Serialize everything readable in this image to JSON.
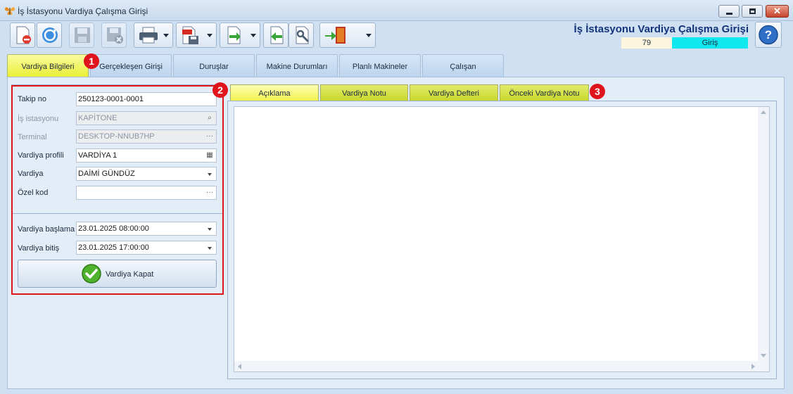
{
  "window": {
    "title": "İş İstasyonu Vardiya Çalışma Girişi",
    "app_icon": "butterfly-icon",
    "controls": {
      "minimize": "minimize-icon",
      "maximize": "maximize-icon",
      "close": "close-icon"
    }
  },
  "toolbar": {
    "buttons": [
      {
        "icon": "new-document-icon"
      },
      {
        "icon": "refresh-icon"
      },
      {
        "icon": "save-icon"
      },
      {
        "icon": "delete-save-icon"
      },
      {
        "icon": "printer-icon"
      },
      {
        "icon": "pdf-export-icon"
      },
      {
        "icon": "import-icon"
      },
      {
        "icon": "back-icon"
      },
      {
        "icon": "tools-icon"
      },
      {
        "icon": "exit-door-icon"
      }
    ]
  },
  "header": {
    "title": "İş İstasyonu Vardiya Çalışma Girişi",
    "counter": "79",
    "mode": "Giriş",
    "mode_color": "#10e8f0",
    "help_icon": "help-icon"
  },
  "main_tabs": [
    {
      "label": "Vardiya Bilgileri",
      "active": true
    },
    {
      "label": "Gerçekleşen Girişi"
    },
    {
      "label": "Duruşlar"
    },
    {
      "label": "Makine Durumları"
    },
    {
      "label": "Planlı Makineler"
    },
    {
      "label": "Çalışan"
    }
  ],
  "form": {
    "tracking_no": {
      "label": "Takip no",
      "value": "250123-0001-0001"
    },
    "workstation": {
      "label": "İş istasyonu",
      "value": "KAPİTONE"
    },
    "terminal": {
      "label": "Terminal",
      "value": "DESKTOP-NNUB7HP"
    },
    "shift_profile": {
      "label": "Vardiya profili",
      "value": "VARDİYA 1"
    },
    "shift": {
      "label": "Vardiya",
      "value": "DAİMİ GÜNDÜZ"
    },
    "special_code": {
      "label": "Özel kod",
      "value": ""
    },
    "shift_start": {
      "label": "Vardiya başlama",
      "value": "23.01.2025 08:00:00"
    },
    "shift_end": {
      "label": "Vardiya bitiş",
      "value": "23.01.2025 17:00:00"
    },
    "close_shift_button": "Vardiya Kapat"
  },
  "sub_tabs": [
    {
      "label": "Açıklama",
      "active": true
    },
    {
      "label": "Vardiya Notu"
    },
    {
      "label": "Vardiya Defteri"
    },
    {
      "label": "Önceki Vardiya Notu"
    }
  ],
  "annotations": [
    "1",
    "2",
    "3"
  ],
  "accent_colors": {
    "active_tab": "#f2f44a",
    "callout": "#e0141c"
  }
}
